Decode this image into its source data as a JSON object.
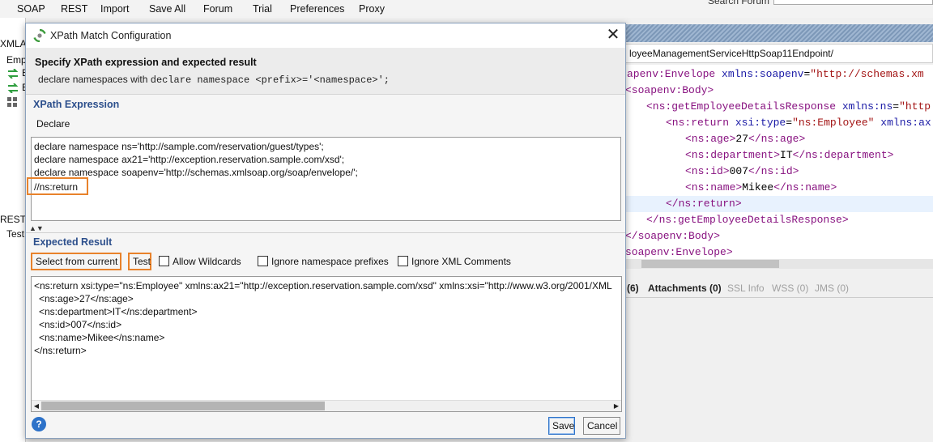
{
  "menubar": {
    "items": [
      "SOAP",
      "REST",
      "Import",
      "Save All",
      "Forum",
      "Trial",
      "Preferences",
      "Proxy"
    ],
    "search_label": "Search Forum"
  },
  "left_panel": {
    "labels": [
      "XMLA",
      "Emp",
      "E",
      "E",
      "REST",
      "TestP"
    ]
  },
  "right_panel": {
    "endpoint": "loyeeManagementServiceHttpSoap11Endpoint/",
    "tabs": [
      {
        "label": "(6)",
        "dim": false
      },
      {
        "label": "Attachments (0)",
        "dim": false
      },
      {
        "label": "SSL Info",
        "dim": true
      },
      {
        "label": "WSS (0)",
        "dim": true
      },
      {
        "label": "JMS (0)",
        "dim": true
      }
    ]
  },
  "dialog": {
    "title": "XPath Match Configuration",
    "header_title": "Specify XPath expression and expected result",
    "header_desc_prefix": "declare namespaces with ",
    "header_desc_code": "declare namespace <prefix>='<namespace>';",
    "xpath_section_title": "XPath Expression",
    "declare_label": "Declare",
    "expression_lines": [
      "declare namespace ns='http://sample.com/reservation/guest/types';",
      "declare namespace ax21='http://exception.reservation.sample.com/xsd';",
      "declare namespace soapenv='http://schemas.xmlsoap.org/soap/envelope/';",
      "//ns:return"
    ],
    "expected_section_title": "Expected Result",
    "select_current_label": "Select from current",
    "test_label": "Test",
    "allow_wildcards_label": "Allow Wildcards",
    "ignore_ns_label": "Ignore namespace prefixes",
    "ignore_comments_label": "Ignore XML Comments",
    "result_lines": [
      "<ns:return xsi:type=\"ns:Employee\" xmlns:ax21=\"http://exception.reservation.sample.com/xsd\" xmlns:xsi=\"http://www.w3.org/2001/XML",
      "  <ns:age>27</ns:age>",
      "  <ns:department>IT</ns:department>",
      "  <ns:id>007</ns:id>",
      "  <ns:name>Mikee</ns:name>",
      "</ns:return>"
    ],
    "help_label": "?",
    "save_label": "Save",
    "cancel_label": "Cancel"
  },
  "colors": {
    "accent_orange": "#e8822b",
    "section_blue": "#2c4f8c",
    "xml_tag": "#881280",
    "xml_attr": "#1a1aa6",
    "xml_value": "#a31515"
  }
}
